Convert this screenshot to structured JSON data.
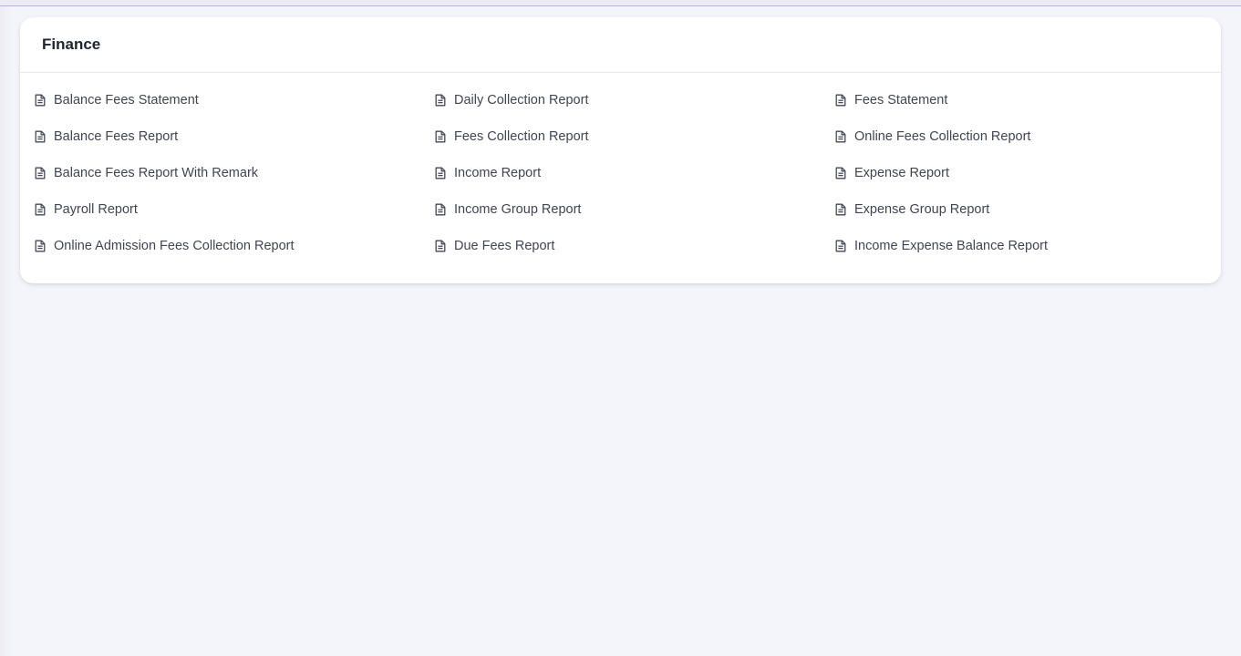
{
  "section": {
    "title": "Finance"
  },
  "reports": {
    "columns": [
      [
        {
          "label": "Balance Fees Statement",
          "icon": "file-text-icon"
        },
        {
          "label": "Balance Fees Report",
          "icon": "file-text-icon"
        },
        {
          "label": "Balance Fees Report With Remark",
          "icon": "file-text-icon"
        },
        {
          "label": "Payroll Report",
          "icon": "file-text-icon"
        },
        {
          "label": "Online Admission Fees Collection Report",
          "icon": "file-text-icon"
        }
      ],
      [
        {
          "label": "Daily Collection Report",
          "icon": "file-text-icon"
        },
        {
          "label": "Fees Collection Report",
          "icon": "file-text-icon"
        },
        {
          "label": "Income Report",
          "icon": "file-text-icon"
        },
        {
          "label": "Income Group Report",
          "icon": "file-text-icon"
        },
        {
          "label": "Due Fees Report",
          "icon": "file-text-icon"
        }
      ],
      [
        {
          "label": "Fees Statement",
          "icon": "file-text-icon"
        },
        {
          "label": "Online Fees Collection Report",
          "icon": "file-text-icon"
        },
        {
          "label": "Expense Report",
          "icon": "file-text-icon"
        },
        {
          "label": "Expense Group Report",
          "icon": "file-text-icon"
        },
        {
          "label": "Income Expense Balance Report",
          "icon": "file-text-icon"
        }
      ]
    ]
  },
  "colors": {
    "background": "#f4f5fb",
    "card": "#ffffff",
    "title_text": "#1f2430",
    "link_text": "#404552",
    "accent_line": "#b6aef0"
  }
}
